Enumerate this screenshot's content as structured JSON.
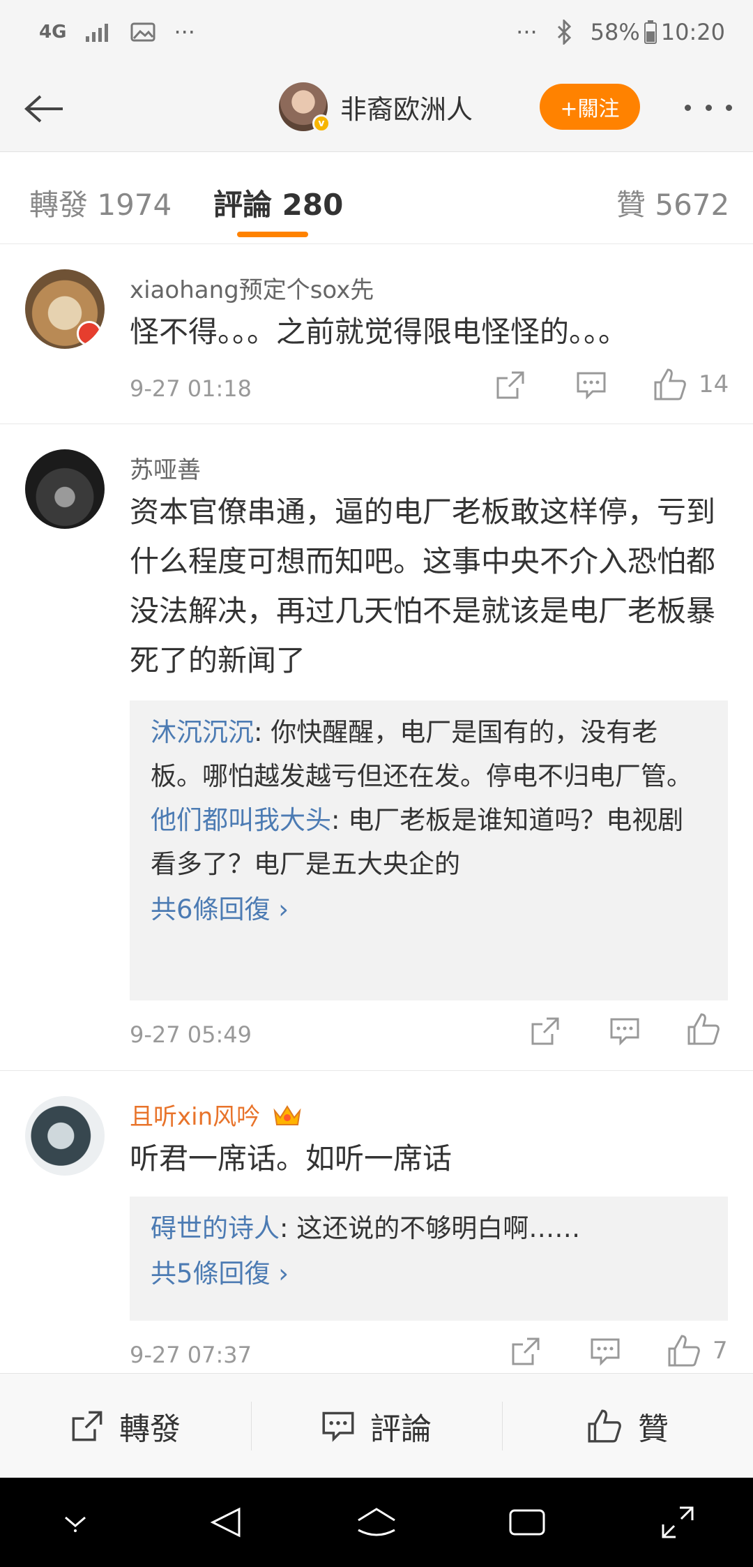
{
  "status_bar": {
    "network": "4G",
    "dots_left": "···",
    "dots_right": "···",
    "battery": "58%",
    "time": "10:20"
  },
  "header": {
    "user_name": "非裔欧洲人",
    "follow_label": "+關注"
  },
  "tabs": {
    "repost": "轉發 1974",
    "comments": "評論 280",
    "likes": "贊 5672"
  },
  "comments": [
    {
      "user": "xiaohang预定个sox先",
      "text": "怪不得。。。之前就觉得限电怪怪的。。。",
      "time": "9-27 01:18",
      "likes": "14"
    },
    {
      "user": "苏哑善",
      "text": "资本官僚串通，逼的电厂老板敢这样停，亏到什么程度可想而知吧。这事中央不介入恐怕都没法解决，再过几天怕不是就该是电厂老板暴死了的新闻了",
      "replies": [
        {
          "user": "沐沉沉沉",
          "text": ": 你快醒醒，电厂是国有的，没有老板。哪怕越发越亏但还在发。停电不归电厂管。"
        },
        {
          "user": "他们都叫我大头",
          "text": ": 电厂老板是谁知道吗？电视剧看多了？电厂是五大央企的"
        }
      ],
      "more_replies": "共6條回復 ›",
      "time": "9-27 05:49",
      "likes": ""
    },
    {
      "user": "且听xin风吟",
      "text": "听君一席话。如听一席话",
      "replies": [
        {
          "user": "碍世的诗人",
          "text": ": 这还说的不够明白啊……"
        }
      ],
      "more_replies": "共5條回復 ›",
      "time": "9-27 07:37",
      "likes": "7"
    }
  ],
  "toolbar": {
    "repost": "轉發",
    "comment": "評論",
    "like": "贊"
  },
  "colors": {
    "accent": "#ff8200",
    "link": "#4c7bb3",
    "vip_name": "#e8732a"
  }
}
